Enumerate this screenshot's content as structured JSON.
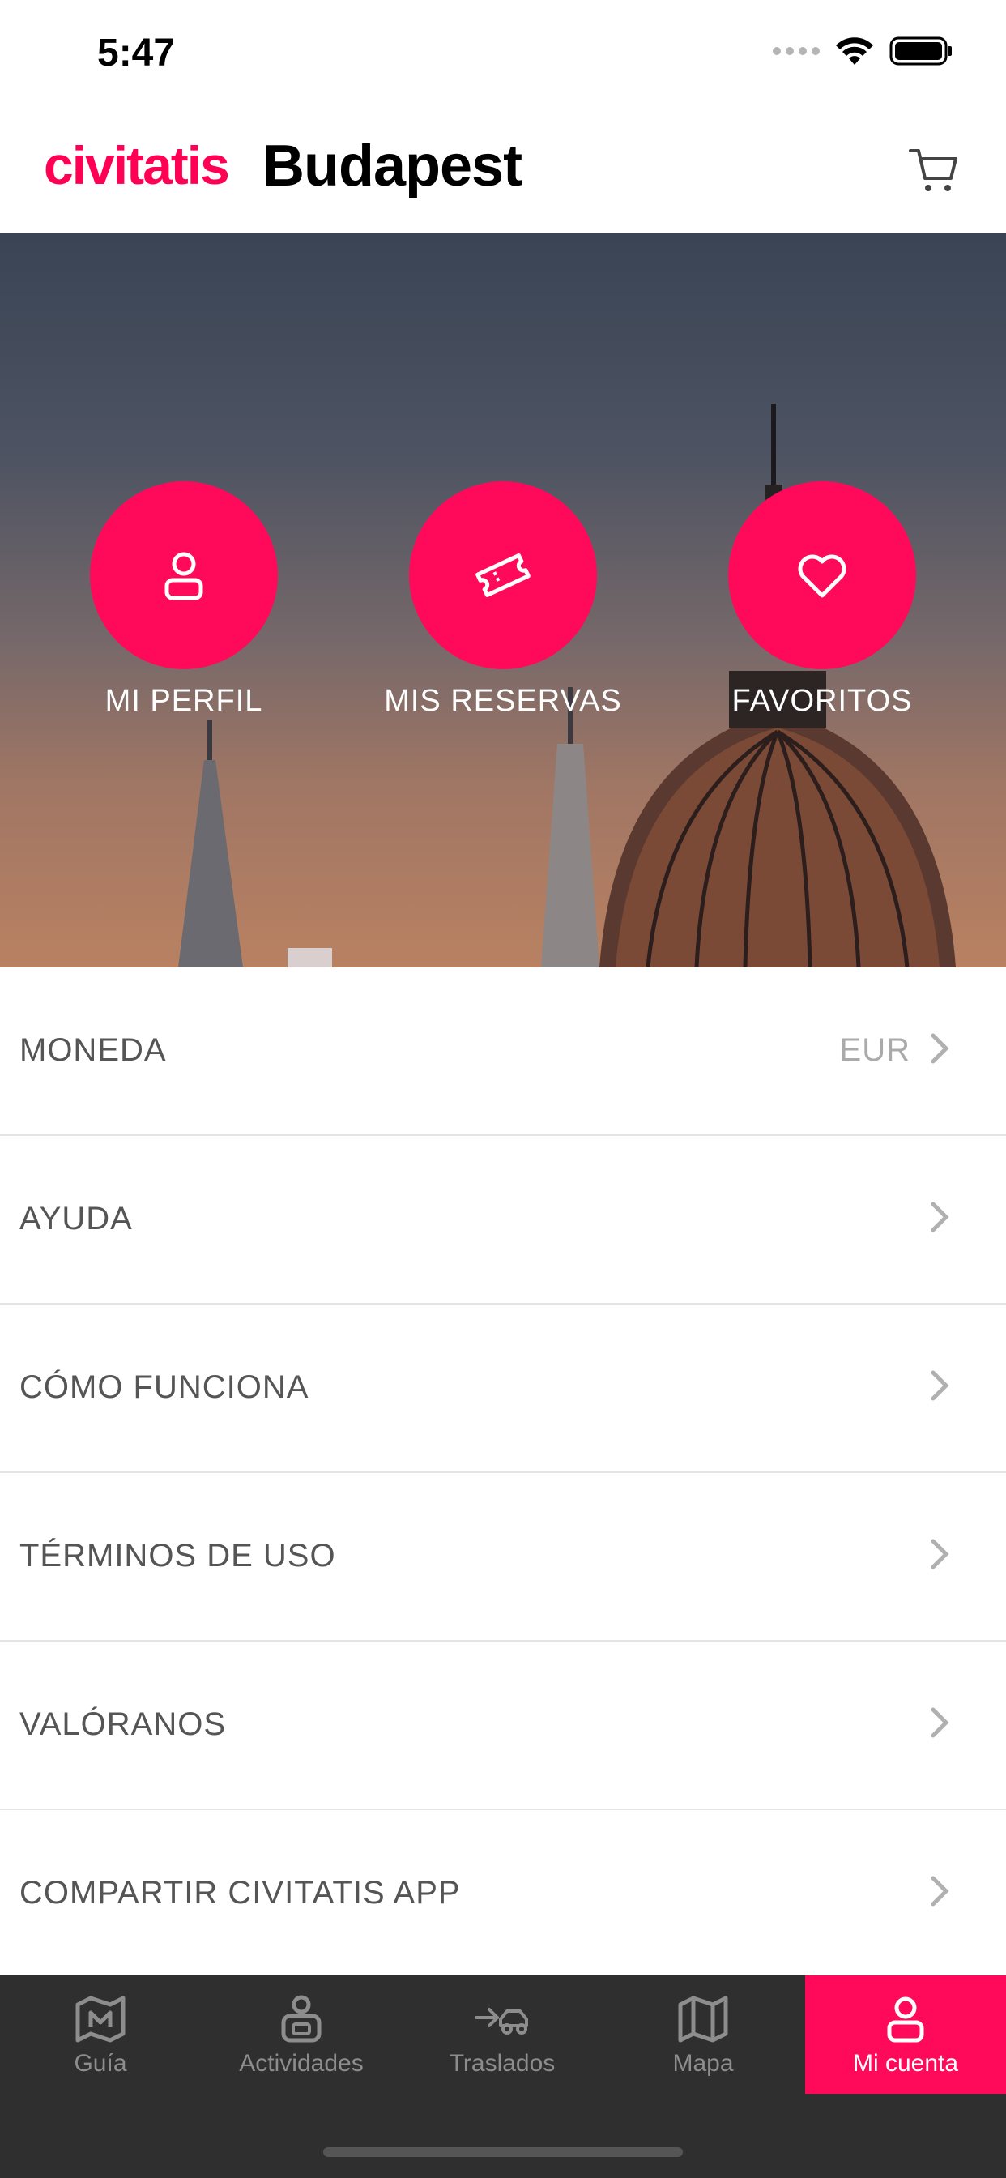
{
  "status_bar": {
    "time": "5:47"
  },
  "header": {
    "brand": "civitatis",
    "city": "Budapest",
    "cart_icon": "cart-icon"
  },
  "hero": {
    "actions": [
      {
        "label": "MI PERFIL",
        "icon": "user-icon"
      },
      {
        "label": "MIS RESERVAS",
        "icon": "ticket-icon"
      },
      {
        "label": "FAVORITOS",
        "icon": "heart-icon"
      }
    ]
  },
  "menu": {
    "items": [
      {
        "label": "MONEDA",
        "value": "EUR"
      },
      {
        "label": "AYUDA"
      },
      {
        "label": "CÓMO FUNCIONA"
      },
      {
        "label": "TÉRMINOS DE USO"
      },
      {
        "label": "VALÓRANOS"
      },
      {
        "label": "COMPARTIR CIVITATIS APP"
      }
    ]
  },
  "tabbar": {
    "tabs": [
      {
        "label": "Guía",
        "icon": "guide-map-icon"
      },
      {
        "label": "Actividades",
        "icon": "activities-icon"
      },
      {
        "label": "Traslados",
        "icon": "transfer-icon"
      },
      {
        "label": "Mapa",
        "icon": "map-icon"
      },
      {
        "label": "Mi cuenta",
        "icon": "account-icon",
        "active": true
      }
    ]
  },
  "colors": {
    "accent": "#ff0a5a",
    "tabbar_bg": "#2f2f2f",
    "menu_text": "#555555"
  }
}
